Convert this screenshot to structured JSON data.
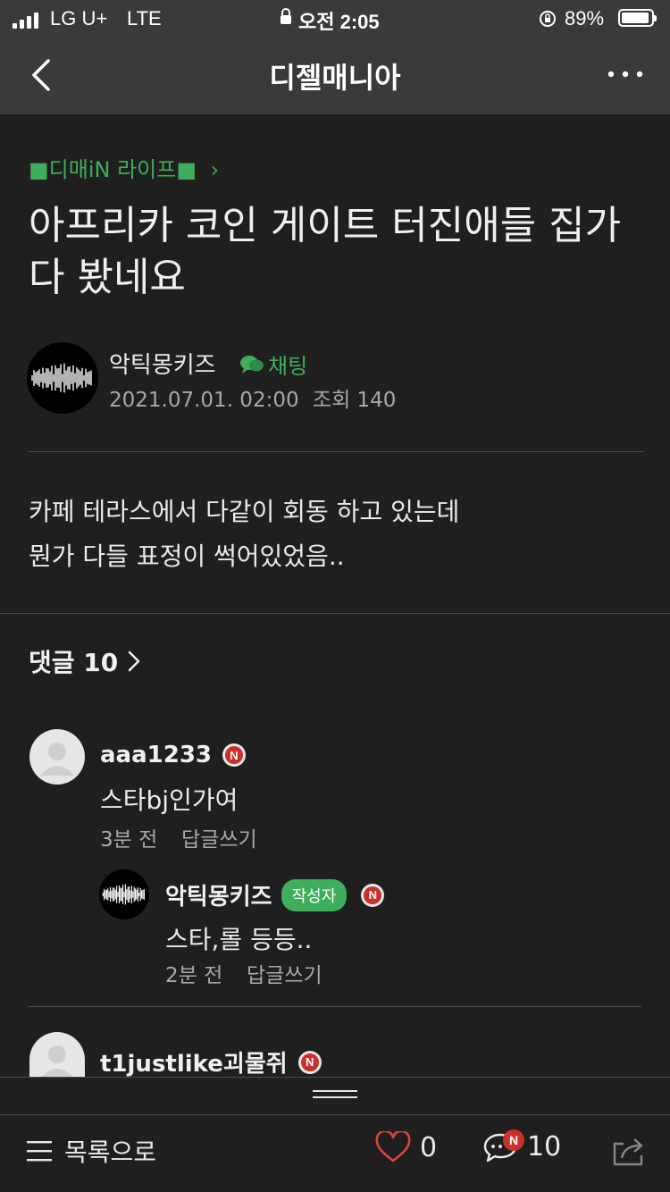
{
  "status": {
    "carrier": "LG U+",
    "network": "LTE",
    "time": "오전 2:05",
    "battery": "89%",
    "battery_level": 0.89
  },
  "nav": {
    "title": "디젤매니아",
    "back_icon": "back-chevron-icon",
    "more_icon": "more-dots-icon"
  },
  "post": {
    "board": "■디매iN 라이프■",
    "title": "아프리카 코인 게이트 터진애들 집가 다 봤네요",
    "author": "악틱몽키즈",
    "chat_label": "채팅",
    "date": "2021.07.01. 02:00",
    "views": "조회 140",
    "body": [
      "카페 테라스에서 다같이 회동 하고 있는데",
      "뭔가 다들 표정이 썩어있었음.."
    ]
  },
  "comments": {
    "header": "댓글 10",
    "items": [
      {
        "name": "aaa1233",
        "badge": "N",
        "text": "스타bj인가여",
        "time": "3분 전",
        "reply": "답글쓰기"
      },
      {
        "name": "악틱몽키즈",
        "writer_badge": "작성자",
        "badge": "N",
        "text": "스타,롤 등등..",
        "time": "2분 전",
        "reply": "답글쓰기"
      },
      {
        "name": "t1justlike괴물쥐",
        "badge": "N"
      }
    ]
  },
  "bottom": {
    "list_label": "목록으로",
    "likes": "0",
    "comments": "10",
    "new_badge": "N"
  },
  "colors": {
    "accent": "#3fae5a",
    "badge_red": "#c9302c",
    "background": "#1f1f1f",
    "bar": "#3a3a3a"
  }
}
